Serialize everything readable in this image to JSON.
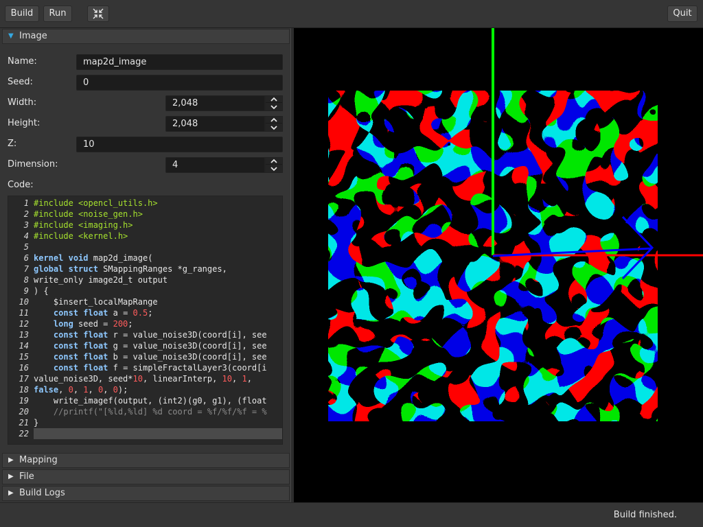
{
  "toolbar": {
    "build_label": "Build",
    "run_label": "Run",
    "collapse_icon": "collapse-arrows-icon",
    "quit_label": "Quit"
  },
  "image_section": {
    "title": "Image",
    "expanded": true,
    "fields": {
      "name": {
        "label": "Name:",
        "value": "map2d_image"
      },
      "seed": {
        "label": "Seed:",
        "value": "0"
      },
      "width": {
        "label": "Width:",
        "value": "2,048"
      },
      "height": {
        "label": "Height:",
        "value": "2,048"
      },
      "z": {
        "label": "Z:",
        "value": "10"
      },
      "dimension": {
        "label": "Dimension:",
        "value": "4"
      }
    },
    "code_label": "Code:"
  },
  "code_editor": {
    "current_line": 22,
    "lines": [
      [
        [
          "pp",
          "#include <opencl_utils.h>"
        ]
      ],
      [
        [
          "pp",
          "#include <noise_gen.h>"
        ]
      ],
      [
        [
          "pp",
          "#include <imaging.h>"
        ]
      ],
      [
        [
          "pp",
          "#include <kernel.h>"
        ]
      ],
      [],
      [
        [
          "kw",
          "kernel"
        ],
        [
          "tx",
          " "
        ],
        [
          "kw",
          "void"
        ],
        [
          "tx",
          " map2d_image("
        ]
      ],
      [
        [
          "kw",
          "global"
        ],
        [
          "tx",
          " "
        ],
        [
          "kw",
          "struct"
        ],
        [
          "tx",
          " SMappingRanges *g_ranges,"
        ]
      ],
      [
        [
          "tx",
          "write_only image2d_t output"
        ]
      ],
      [
        [
          "tx",
          ") {"
        ]
      ],
      [
        [
          "tx",
          "    $insert_localMapRange"
        ]
      ],
      [
        [
          "tx",
          "    "
        ],
        [
          "kw",
          "const"
        ],
        [
          "tx",
          " "
        ],
        [
          "kw",
          "float"
        ],
        [
          "tx",
          " a = "
        ],
        [
          "num",
          "0.5"
        ],
        [
          "tx",
          ";"
        ]
      ],
      [
        [
          "tx",
          "    "
        ],
        [
          "kw",
          "long"
        ],
        [
          "tx",
          " seed = "
        ],
        [
          "num",
          "200"
        ],
        [
          "tx",
          ";"
        ]
      ],
      [
        [
          "tx",
          "    "
        ],
        [
          "kw",
          "const"
        ],
        [
          "tx",
          " "
        ],
        [
          "kw",
          "float"
        ],
        [
          "tx",
          " r = value_noise3D(coord[i], see"
        ]
      ],
      [
        [
          "tx",
          "    "
        ],
        [
          "kw",
          "const"
        ],
        [
          "tx",
          " "
        ],
        [
          "kw",
          "float"
        ],
        [
          "tx",
          " g = value_noise3D(coord[i], see"
        ]
      ],
      [
        [
          "tx",
          "    "
        ],
        [
          "kw",
          "const"
        ],
        [
          "tx",
          " "
        ],
        [
          "kw",
          "float"
        ],
        [
          "tx",
          " b = value_noise3D(coord[i], see"
        ]
      ],
      [
        [
          "tx",
          "    "
        ],
        [
          "kw",
          "const"
        ],
        [
          "tx",
          " "
        ],
        [
          "kw",
          "float"
        ],
        [
          "tx",
          " f = simpleFractalLayer3(coord[i"
        ]
      ],
      [
        [
          "tx",
          "value_noise3D, seed*"
        ],
        [
          "num",
          "10"
        ],
        [
          "tx",
          ", linearInterp, "
        ],
        [
          "num",
          "10"
        ],
        [
          "tx",
          ", "
        ],
        [
          "num",
          "1"
        ],
        [
          "tx",
          ","
        ]
      ],
      [
        [
          "kw",
          "false"
        ],
        [
          "tx",
          ", "
        ],
        [
          "num",
          "0"
        ],
        [
          "tx",
          ", "
        ],
        [
          "num",
          "1"
        ],
        [
          "tx",
          ", "
        ],
        [
          "num",
          "0"
        ],
        [
          "tx",
          ", "
        ],
        [
          "num",
          "0"
        ],
        [
          "tx",
          ");"
        ]
      ],
      [
        [
          "tx",
          "    write_imagef(output, (int2)(g0, g1), (float"
        ]
      ],
      [
        [
          "tx",
          "    "
        ],
        [
          "cm",
          "//printf(\"[%ld,%ld] %d coord = %f/%f/%f = %"
        ]
      ],
      [
        [
          "tx",
          "}"
        ]
      ],
      []
    ]
  },
  "collapsed_sections": [
    {
      "title": "Mapping"
    },
    {
      "title": "File"
    },
    {
      "title": "Build Logs"
    }
  ],
  "viewport": {
    "axis_colors": {
      "x": "#ff0000",
      "y": "#00ff00",
      "z": "#0000ff"
    },
    "noise_palette": [
      "#000000",
      "#e40000",
      "#00c8c8",
      "#cfcfcf"
    ]
  },
  "status": {
    "text": "Build finished."
  }
}
